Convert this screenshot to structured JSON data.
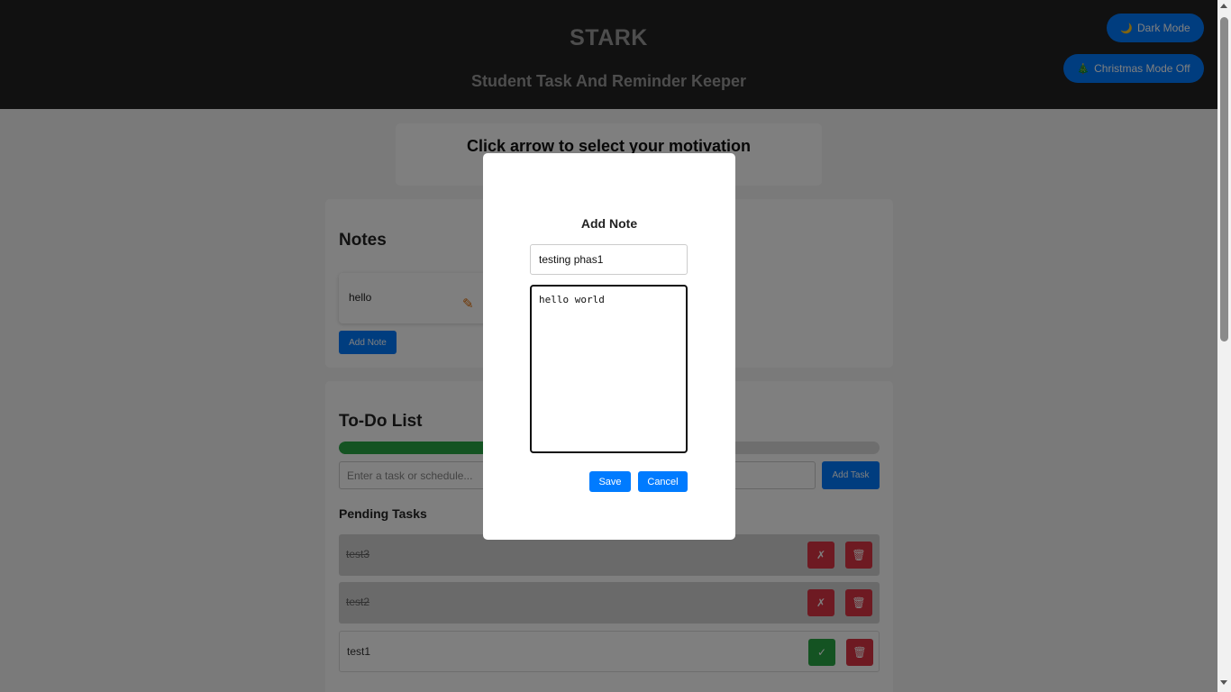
{
  "header": {
    "title": "STARK",
    "subtitle": "Student Task And Reminder Keeper",
    "dark_mode_icon": "moon-icon",
    "dark_mode_label": "Dark Mode",
    "christmas_icon": "christmas-tree-icon",
    "christmas_label": "Christmas Mode Off"
  },
  "motivation": {
    "text": "Click arrow to select your motivation"
  },
  "notes": {
    "title": "Notes",
    "items": [
      {
        "text": "hello",
        "edit_icon": "pencil-icon"
      }
    ],
    "add_button": "Add Note"
  },
  "todo": {
    "title": "To-Do List",
    "progress_percent": 67,
    "progress_color": "#28a745",
    "input_placeholder": "Enter a task or schedule...",
    "add_button": "Add Task",
    "pending_title": "Pending Tasks",
    "tasks": [
      {
        "text": "test3",
        "completed": true,
        "toggle_glyph": "✗",
        "delete_glyph": "🗑"
      },
      {
        "text": "test2",
        "completed": true,
        "toggle_glyph": "✗",
        "delete_glyph": "🗑"
      },
      {
        "text": "test1",
        "completed": false,
        "toggle_glyph": "✓",
        "delete_glyph": "🗑"
      }
    ]
  },
  "modal": {
    "title": "Add Note",
    "note_title_value": "testing phas1",
    "note_body_value": "hello world",
    "save_label": "Save",
    "cancel_label": "Cancel"
  },
  "colors": {
    "accent": "#007bff",
    "header_bg": "#222222",
    "danger": "#dc3545",
    "success": "#28a745"
  }
}
